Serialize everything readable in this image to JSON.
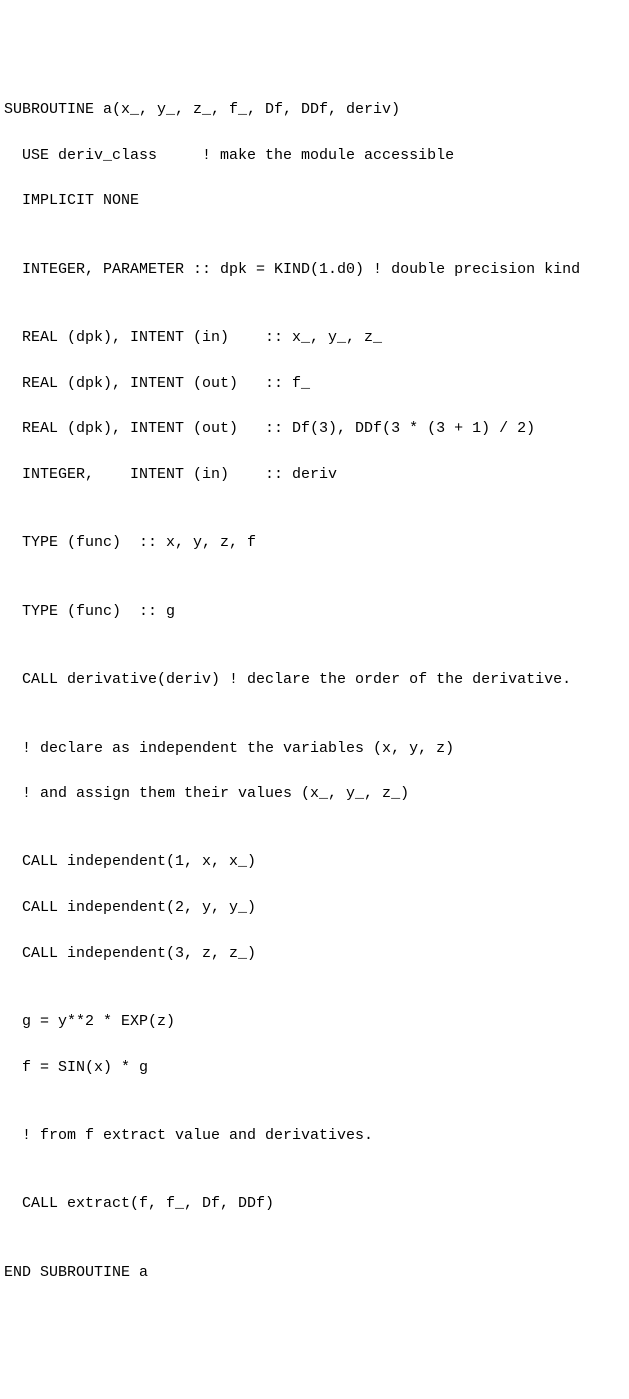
{
  "code": {
    "l0": "SUBROUTINE a(x_, y_, z_, f_, Df, DDf, deriv)",
    "l1": "  USE deriv_class     ! make the module accessible",
    "l2": "  IMPLICIT NONE",
    "l3": "",
    "l4": "  INTEGER, PARAMETER :: dpk = KIND(1.d0) ! double precision kind",
    "l5": "",
    "l6": "  REAL (dpk), INTENT (in)    :: x_, y_, z_",
    "l7": "  REAL (dpk), INTENT (out)   :: f_",
    "l8": "  REAL (dpk), INTENT (out)   :: Df(3), DDf(3 * (3 + 1) / 2)",
    "l9": "  INTEGER,    INTENT (in)    :: deriv",
    "l10": "",
    "l11": "  TYPE (func)  :: x, y, z, f",
    "l12": "",
    "l13": "  TYPE (func)  :: g",
    "l14": "",
    "l15": "  CALL derivative(deriv) ! declare the order of the derivative.",
    "l16": "",
    "l17": "  ! declare as independent the variables (x, y, z)",
    "l18": "  ! and assign them their values (x_, y_, z_)",
    "l19": "",
    "l20": "  CALL independent(1, x, x_)",
    "l21": "  CALL independent(2, y, y_)",
    "l22": "  CALL independent(3, z, z_)",
    "l23": "",
    "l24": "  g = y**2 * EXP(z)",
    "l25": "  f = SIN(x) * g",
    "l26": "",
    "l27": "  ! from f extract value and derivatives.",
    "l28": "",
    "l29": "  CALL extract(f, f_, Df, DDf)",
    "l30": "",
    "l31": "END SUBROUTINE a"
  }
}
